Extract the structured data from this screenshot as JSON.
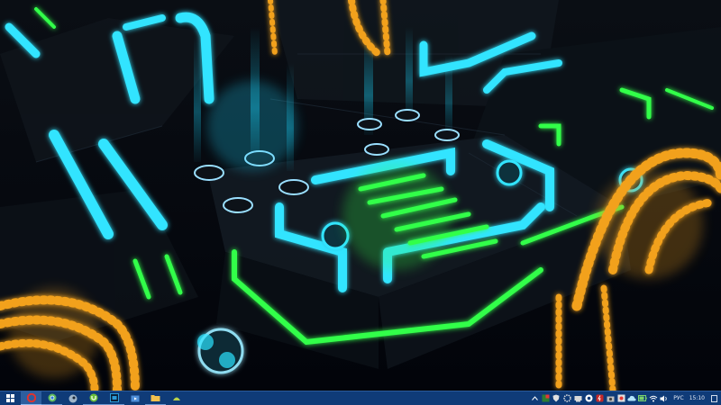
{
  "desktop": {
    "wallpaper": "neon-machinery-3d-wallpaper"
  },
  "taskbar": {
    "start_icon": "windows-logo-icon",
    "pinned": [
      {
        "icon": "opera-browser-icon",
        "color": "#e0322e",
        "state": "active"
      },
      {
        "icon": "chrome-browser-icon",
        "color": "#5cb85c",
        "state": "open"
      },
      {
        "icon": "steam-app-icon",
        "color": "#9fb5c9",
        "state": "none"
      },
      {
        "icon": "utorrent-icon",
        "color": "#6bbf3a",
        "state": "open"
      },
      {
        "icon": "photoshop-icon",
        "color": "#2b9bd8",
        "state": "open"
      },
      {
        "icon": "video-player-icon",
        "color": "#4f8fd9",
        "state": "none"
      },
      {
        "icon": "file-explorer-icon",
        "color": "#f2c14e",
        "state": "open"
      },
      {
        "icon": "media-app-icon",
        "color": "#b8d14a",
        "state": "none"
      }
    ],
    "tray": {
      "icons": [
        "chevron-up-icon",
        "notification-app-icon",
        "shield-icon",
        "gear-icon",
        "network-device-icon",
        "speaker-icon",
        "flash-icon",
        "camera-icon",
        "record-icon",
        "cloud-icon",
        "battery-icon",
        "wifi-icon",
        "volume-icon"
      ],
      "language": "РУС",
      "time": "15:10",
      "notify_icon": "action-center-icon"
    }
  }
}
